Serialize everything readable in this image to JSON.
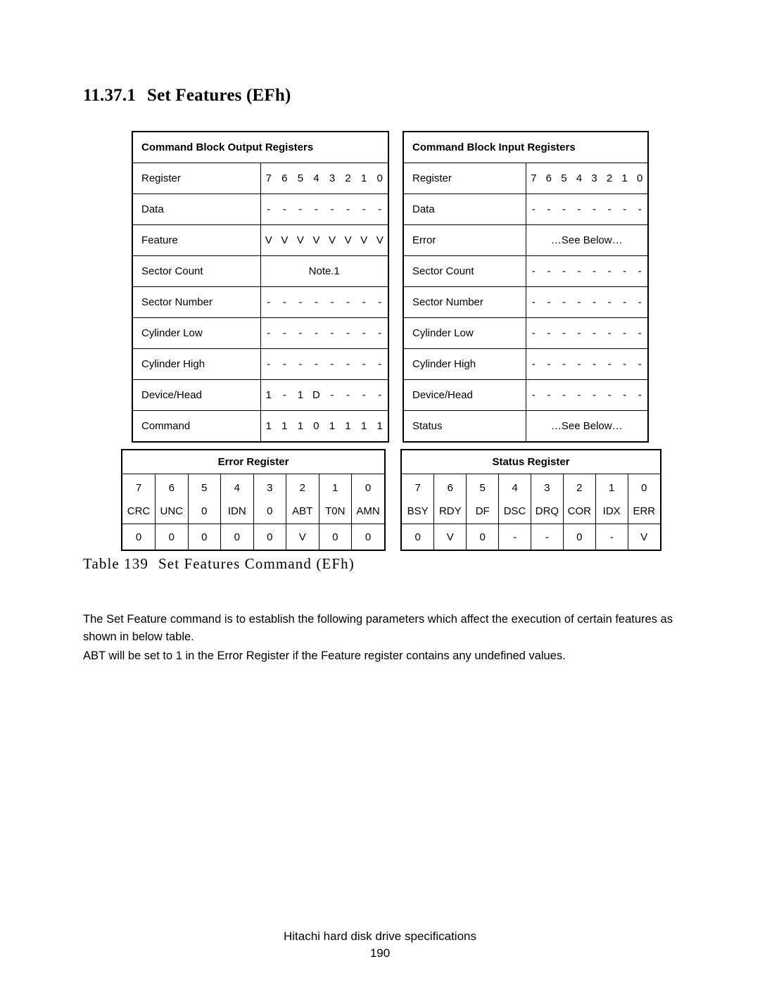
{
  "heading": {
    "number": "11.37.1",
    "title": "Set Features (EFh)"
  },
  "output_registers": {
    "title": "Command Block Output Registers",
    "label_column_header": "Register",
    "bit_headers": [
      "7",
      "6",
      "5",
      "4",
      "3",
      "2",
      "1",
      "0"
    ],
    "rows": [
      {
        "label": "Data",
        "type": "bits",
        "values": [
          "-",
          "-",
          "-",
          "-",
          "-",
          "-",
          "-",
          "-"
        ]
      },
      {
        "label": "Feature",
        "type": "bits",
        "values": [
          "V",
          "V",
          "V",
          "V",
          "V",
          "V",
          "V",
          "V"
        ]
      },
      {
        "label": "Sector Count",
        "type": "span",
        "text": "Note.1"
      },
      {
        "label": "Sector Number",
        "type": "bits",
        "values": [
          "-",
          "-",
          "-",
          "-",
          "-",
          "-",
          "-",
          "-"
        ]
      },
      {
        "label": "Cylinder Low",
        "type": "bits",
        "values": [
          "-",
          "-",
          "-",
          "-",
          "-",
          "-",
          "-",
          "-"
        ]
      },
      {
        "label": "Cylinder High",
        "type": "bits",
        "values": [
          "-",
          "-",
          "-",
          "-",
          "-",
          "-",
          "-",
          "-"
        ]
      },
      {
        "label": "Device/Head",
        "type": "bits",
        "values": [
          "1",
          "-",
          "1",
          "D",
          "-",
          "-",
          "-",
          "-"
        ]
      },
      {
        "label": "Command",
        "type": "bits",
        "values": [
          "1",
          "1",
          "1",
          "0",
          "1",
          "1",
          "1",
          "1"
        ]
      }
    ]
  },
  "input_registers": {
    "title": "Command Block Input Registers",
    "label_column_header": "Register",
    "bit_headers": [
      "7",
      "6",
      "5",
      "4",
      "3",
      "2",
      "1",
      "0"
    ],
    "rows": [
      {
        "label": "Data",
        "type": "bits",
        "values": [
          "-",
          "-",
          "-",
          "-",
          "-",
          "-",
          "-",
          "-"
        ]
      },
      {
        "label": "Error",
        "type": "span",
        "text": "…See Below…"
      },
      {
        "label": "Sector Count",
        "type": "bits",
        "values": [
          "-",
          "-",
          "-",
          "-",
          "-",
          "-",
          "-",
          "-"
        ]
      },
      {
        "label": "Sector Number",
        "type": "bits",
        "values": [
          "-",
          "-",
          "-",
          "-",
          "-",
          "-",
          "-",
          "-"
        ]
      },
      {
        "label": "Cylinder Low",
        "type": "bits",
        "values": [
          "-",
          "-",
          "-",
          "-",
          "-",
          "-",
          "-",
          "-"
        ]
      },
      {
        "label": "Cylinder High",
        "type": "bits",
        "values": [
          "-",
          "-",
          "-",
          "-",
          "-",
          "-",
          "-",
          "-"
        ]
      },
      {
        "label": "Device/Head",
        "type": "bits",
        "values": [
          "-",
          "-",
          "-",
          "-",
          "-",
          "-",
          "-",
          "-"
        ]
      },
      {
        "label": "Status",
        "type": "span",
        "text": "…See Below…"
      }
    ]
  },
  "error_register": {
    "title": "Error Register",
    "bits": [
      "7",
      "6",
      "5",
      "4",
      "3",
      "2",
      "1",
      "0"
    ],
    "names": [
      "CRC",
      "UNC",
      "0",
      "IDN",
      "0",
      "ABT",
      "T0N",
      "AMN"
    ],
    "values": [
      "0",
      "0",
      "0",
      "0",
      "0",
      "V",
      "0",
      "0"
    ]
  },
  "status_register": {
    "title": "Status Register",
    "bits": [
      "7",
      "6",
      "5",
      "4",
      "3",
      "2",
      "1",
      "0"
    ],
    "names": [
      "BSY",
      "RDY",
      "DF",
      "DSC",
      "DRQ",
      "COR",
      "IDX",
      "ERR"
    ],
    "values": [
      "0",
      "V",
      "0",
      "-",
      "-",
      "0",
      "-",
      "V"
    ]
  },
  "caption": {
    "number": "Table 139",
    "text": "Set Features Command (EFh)"
  },
  "paragraphs": {
    "intro": "The Set Feature command is to establish the following parameters which affect the execution of certain features as shown in below table.",
    "abt": "ABT will be set to 1 in the Error Register if the Feature register contains any undefined values."
  },
  "footer": {
    "title": "Hitachi hard disk drive specifications",
    "page_number": "190"
  }
}
